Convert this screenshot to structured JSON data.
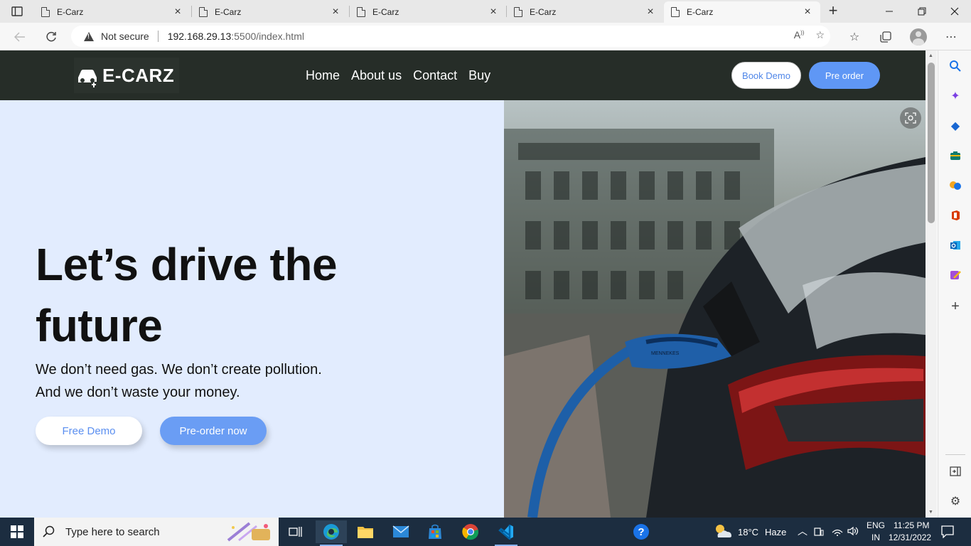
{
  "browser": {
    "tabs": [
      {
        "title": "E-Carz"
      },
      {
        "title": "E-Carz"
      },
      {
        "title": "E-Carz"
      },
      {
        "title": "E-Carz"
      },
      {
        "title": "E-Carz"
      }
    ],
    "security_label": "Not secure",
    "url_host": "192.168.29.13",
    "url_rest": ":5500/index.html"
  },
  "site": {
    "logo": "E-CARZ",
    "nav": [
      "Home",
      "About us",
      "Contact",
      "Buy"
    ],
    "book_demo": "Book Demo",
    "pre_order": "Pre order"
  },
  "hero": {
    "title": "Let’s drive the future",
    "subtitle": "We don’t need gas. We don’t create pollution. And we don’t waste your money.",
    "free_demo": "Free Demo",
    "preorder_now": "Pre-order now",
    "plug_brand": "MENNEKES"
  },
  "taskbar": {
    "search_placeholder": "Type here to search",
    "weather_temp": "18°C",
    "weather_desc": "Haze",
    "lang": "ENG",
    "region": "IN",
    "time": "11:25 PM",
    "date": "12/31/2022"
  },
  "colors": {
    "header_bg": "#262d28",
    "hero_bg": "#e2ecfe",
    "accent_blue": "#5f97f5",
    "taskbar_bg": "#1c2d40"
  }
}
